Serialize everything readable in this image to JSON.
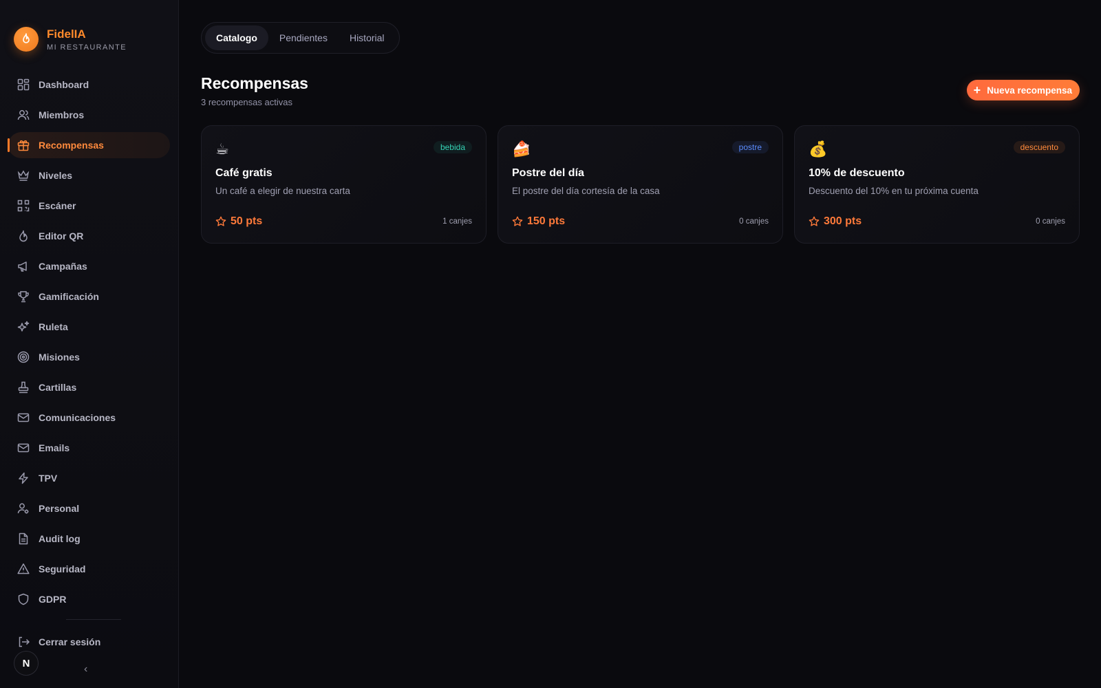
{
  "brand": {
    "name": "FidelIA",
    "subtitle": "MI RESTAURANTE"
  },
  "sidebar": {
    "items": [
      {
        "label": "Dashboard",
        "icon": "dashboard-icon"
      },
      {
        "label": "Miembros",
        "icon": "users-icon"
      },
      {
        "label": "Recompensas",
        "icon": "gift-icon",
        "active": true
      },
      {
        "label": "Niveles",
        "icon": "crown-icon"
      },
      {
        "label": "Escáner",
        "icon": "qr-scan-icon"
      },
      {
        "label": "Editor QR",
        "icon": "flame-icon"
      },
      {
        "label": "Campañas",
        "icon": "megaphone-icon"
      },
      {
        "label": "Gamificación",
        "icon": "trophy-icon"
      },
      {
        "label": "Ruleta",
        "icon": "sparkles-icon"
      },
      {
        "label": "Misiones",
        "icon": "target-icon"
      },
      {
        "label": "Cartillas",
        "icon": "stamp-icon"
      },
      {
        "label": "Comunicaciones",
        "icon": "mail-icon"
      },
      {
        "label": "Emails",
        "icon": "mail-icon"
      },
      {
        "label": "TPV",
        "icon": "bolt-icon"
      },
      {
        "label": "Personal",
        "icon": "user-gear-icon"
      },
      {
        "label": "Audit log",
        "icon": "document-icon"
      },
      {
        "label": "Seguridad",
        "icon": "warning-icon"
      },
      {
        "label": "GDPR",
        "icon": "shield-icon"
      }
    ],
    "logout_label": "Cerrar sesión",
    "avatar_letter": "N",
    "collapse_glyph": "‹"
  },
  "tabs": [
    {
      "label": "Catalogo",
      "active": true
    },
    {
      "label": "Pendientes",
      "active": false
    },
    {
      "label": "Historial",
      "active": false
    }
  ],
  "page": {
    "title": "Recompensas",
    "subtitle": "3 recompensas activas",
    "new_button_label": "Nueva recompensa"
  },
  "rewards": [
    {
      "emoji": "☕",
      "tag": "bebida",
      "title": "Café gratis",
      "description": "Un café a elegir de nuestra carta",
      "points": "50 pts",
      "redemptions": "1 canjes"
    },
    {
      "emoji": "🍰",
      "tag": "postre",
      "title": "Postre del día",
      "description": "El postre del día cortesía de la casa",
      "points": "150 pts",
      "redemptions": "0 canjes"
    },
    {
      "emoji": "💰",
      "tag": "descuento",
      "title": "10% de descuento",
      "description": "Descuento del 10% en tu próxima cuenta",
      "points": "300 pts",
      "redemptions": "0 canjes"
    }
  ],
  "colors": {
    "accent": "#ff7a28",
    "background": "#0a0a0e",
    "sidebar": "#101016"
  }
}
